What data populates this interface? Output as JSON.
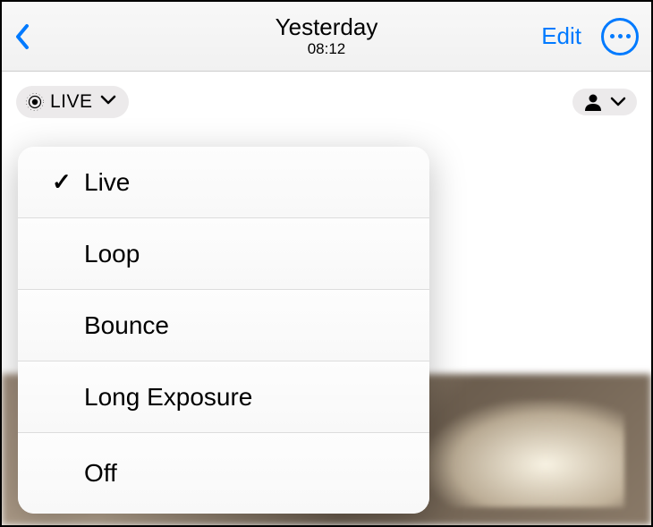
{
  "header": {
    "title": "Yesterday",
    "subtitle": "08:12",
    "edit_label": "Edit"
  },
  "live_badge": {
    "label": "LIVE"
  },
  "dropdown": {
    "items": [
      {
        "label": "Live",
        "selected": true
      },
      {
        "label": "Loop",
        "selected": false
      },
      {
        "label": "Bounce",
        "selected": false
      },
      {
        "label": "Long Exposure",
        "selected": false
      },
      {
        "label": "Off",
        "selected": false
      }
    ]
  }
}
